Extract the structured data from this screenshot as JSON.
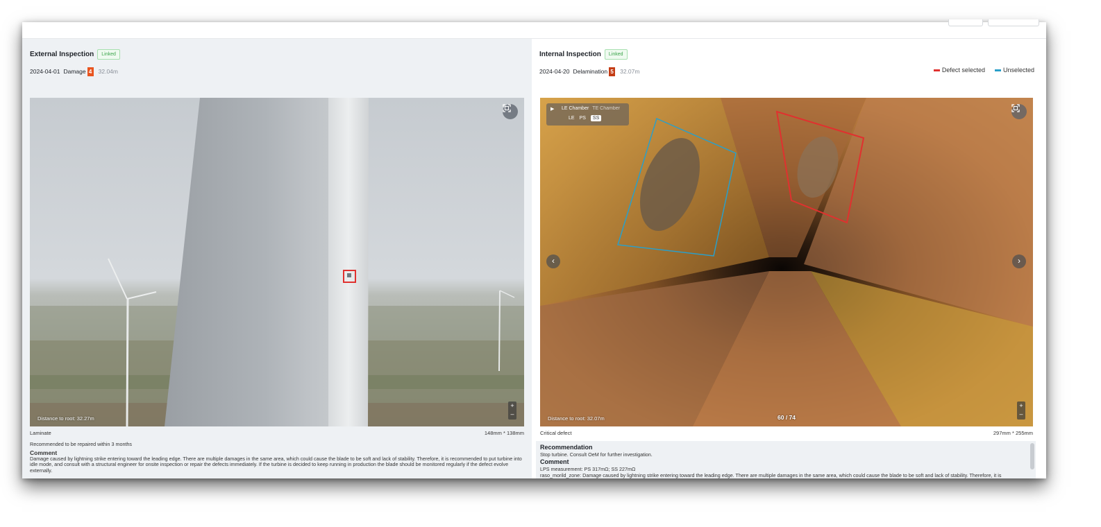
{
  "left": {
    "title": "External Inspection",
    "linked_label": "Linked",
    "date": "2024-04-01",
    "defect_type": "Damage",
    "severity": "4",
    "distance": "32.04m",
    "distance_overlay": "Distance to root:  32.27m",
    "layer": "Laminate",
    "size": "148mm * 138mm",
    "recommendation": "Recommended to be repaired within 3 months",
    "comment_label": "Comment",
    "comment": "Damage caused by lightning strike entering toward the leading edge. There are multiple damages in the same area, which could cause the blade to be soft and lack of stability. Therefore, it is recommended to put turbine into idle mode, and consult with a structural engineer for onsite inspection or repair the defects immediately. If the turbine is decided to keep running in production the blade should be monitored regularly if the defect evolve externally."
  },
  "right": {
    "title": "Internal Inspection",
    "linked_label": "Linked",
    "date": "2024-04-20",
    "defect_type": "Delamination",
    "severity": "5",
    "distance": "32.07m",
    "legend_selected": "Defect selected",
    "legend_unselected": "Unselected",
    "chamber_tabs": [
      "LE Chamber",
      "TE Chamber"
    ],
    "chamber_sub": [
      "LE",
      "PS",
      "SS"
    ],
    "chamber_sub_active": "SS",
    "distance_overlay": "Distance to root:  32.07m",
    "counter": "60 / 74",
    "classification": "Critical defect",
    "size": "297mm * 255mm",
    "recommendation_label": "Recommendation",
    "recommendation": "Stop turbine. Consult OeM for further investigation.",
    "comment_label": "Comment",
    "lps": "LPS measurement: PS 317mΩ; SS 227mΩ",
    "comment_partial": "raso_morild_zone: Damage caused by lightning strike entering toward the leading edge. There are multiple damages in the same area, which could cause the blade to be soft and lack of stability. Therefore, it is"
  },
  "colors": {
    "selected": "#e0312f",
    "unselected": "#2a9fc9",
    "severity4": "#e8541f",
    "severity5": "#c43d16",
    "linked_green": "#3aa44a"
  },
  "icons": [
    "fullscreen-icon",
    "play-icon",
    "chevron-left-icon",
    "chevron-right-icon",
    "zoom-in-icon",
    "zoom-out-icon"
  ]
}
